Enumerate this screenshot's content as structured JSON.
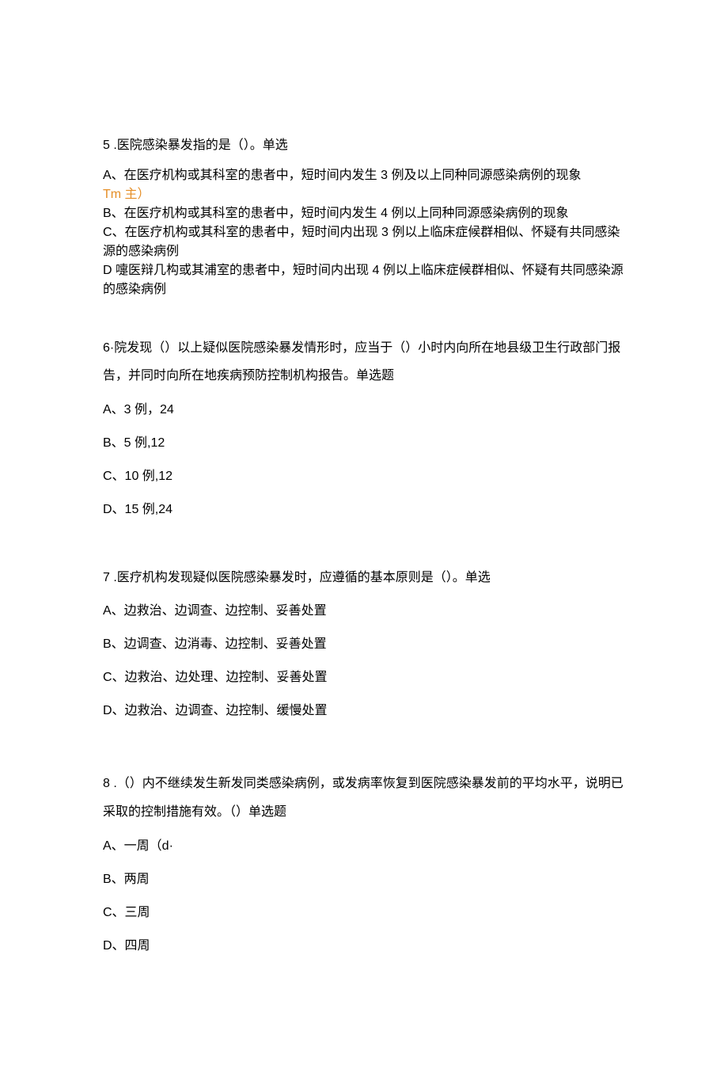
{
  "q5": {
    "stem": "5 .医院感染暴发指的是（）。单选",
    "a": "A、在医疗机构或其科室的患者中，短时间内发生 3 例及以上同种同源感染病例的现象",
    "a_note": "Tm 主）",
    "b": "B、在医疗机构或其科室的患者中，短时间内发生 4 例以上同种同源感染病例的现象",
    "c": "C、在医疗机构或其科室的患者中，短时间内出现 3 例以上临床症候群相似、怀疑有共同感染源的感染病例",
    "d": "D 嚏医辩几构或其浦室的患者中，短时间内出现 4 例以上临床症候群相似、怀疑有共同感染源的感染病例"
  },
  "q6": {
    "stem": "6·院发现（）以上疑似医院感染暴发情形时，应当于（）小时内向所在地县级卫生行政部门报告，并同时向所在地疾病预防控制机构报告。单选题",
    "a": "A、3 例，24",
    "b": "B、5 例,12",
    "c": "C、10 例,12",
    "d": "D、15 例,24"
  },
  "q7": {
    "stem": "7 .医疗机构发现疑似医院感染暴发时，应遵循的基本原则是（）。单选",
    "a": "A、边救治、边调查、边控制、妥善处置",
    "b": "B、边调查、边消毒、边控制、妥善处置",
    "c": "C、边救治、边处理、边控制、妥善处置",
    "d": "D、边救治、边调查、边控制、缓慢处置"
  },
  "q8": {
    "stem": "8 .（）内不继续发生新发同类感染病例，或发病率恢复到医院感染暴发前的平均水平，说明已采取的控制措施有效。（）单选题",
    "a": "A、一周（d·",
    "b": "B、两周",
    "c": "C、三周",
    "d": "D、四周"
  }
}
